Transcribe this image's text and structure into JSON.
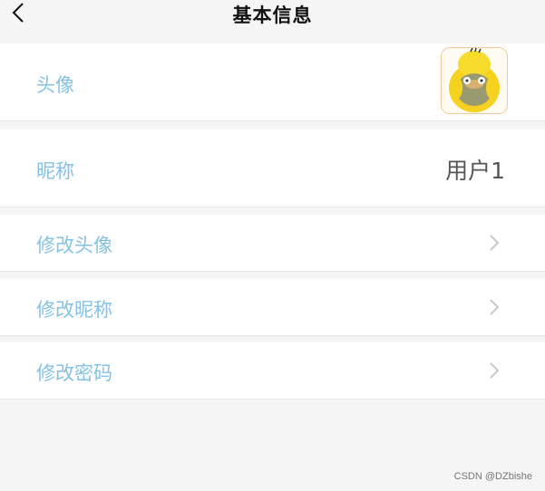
{
  "header": {
    "title": "基本信息",
    "back_icon": "chevron-left-icon"
  },
  "rows": [
    {
      "label": "头像",
      "type": "avatar"
    },
    {
      "label": "昵称",
      "value": "用户1"
    },
    {
      "label": "修改头像",
      "icon": "chevron-right-icon"
    },
    {
      "label": "修改昵称",
      "icon": "chevron-right-icon"
    },
    {
      "label": "修改密码",
      "icon": "chevron-right-icon"
    }
  ],
  "watermark": "CSDN @DZbishe",
  "colors": {
    "label": "#83c2e6",
    "background": "#f5f5f5",
    "row": "#ffffff"
  }
}
